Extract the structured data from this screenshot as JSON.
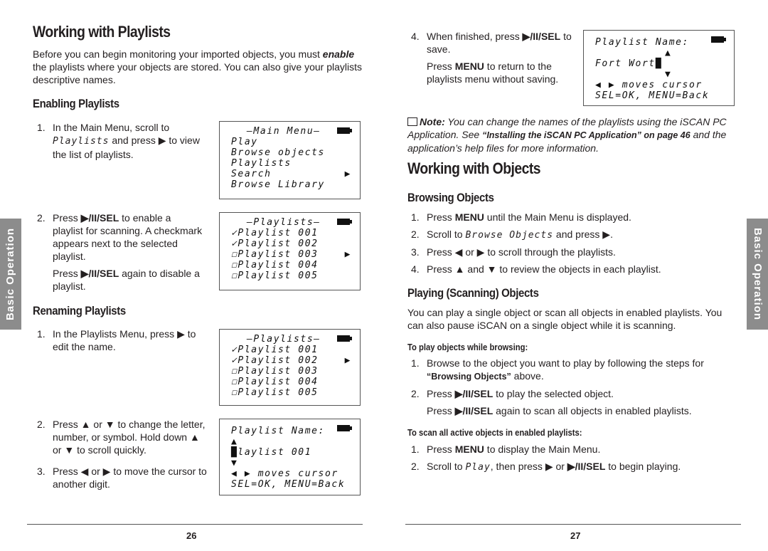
{
  "left": {
    "title": "Working with Playlists",
    "intro": [
      [
        "n",
        "Before you can begin monitoring your imported objects, you must "
      ],
      [
        "bi",
        "enable"
      ],
      [
        "n",
        " the playlists where your objects are stored. You can also give your playlists descriptive names."
      ]
    ],
    "enabling_heading": "Enabling Playlists",
    "enabling_steps": [
      {
        "num": "1.",
        "text": [
          [
            "n",
            "In the Main Menu, scroll to "
          ],
          [
            "lcd",
            "Playlists"
          ],
          [
            "n",
            " and press ▶ to view the list of playlists."
          ]
        ]
      },
      {
        "num": "2.",
        "text": [
          [
            "n",
            "Press "
          ],
          [
            "b",
            "▶/II/SEL"
          ],
          [
            "n",
            " to enable a playlist for scanning. A checkmark appears next to the selected playlist."
          ]
        ],
        "extra": [
          [
            "n",
            "Press "
          ],
          [
            "b",
            "▶/II/SEL"
          ],
          [
            "n",
            " again to disable a playlist."
          ]
        ]
      }
    ],
    "renaming_heading": "Renaming Playlists",
    "renaming_steps": [
      {
        "num": "1.",
        "text": [
          [
            "n",
            "In the Playlists Menu, press ▶ to edit the name."
          ]
        ]
      },
      {
        "num": "2.",
        "text": [
          [
            "n",
            "Press ▲ or ▼ to change the letter, number, or symbol. Hold down ▲ or ▼ to scroll quickly."
          ]
        ]
      },
      {
        "num": "3.",
        "text": [
          [
            "n",
            "Press ◀ or ▶ to move the cursor to another digit."
          ]
        ]
      }
    ],
    "lcd_main_menu": {
      "title": "–Main Menu–",
      "items": [
        "Play",
        "Browse objects",
        "Playlists",
        "Search",
        "Browse Library"
      ],
      "arrow": "▶"
    },
    "lcd_playlists_a": {
      "title": "–Playlists–",
      "items": [
        "✓Playlist 001",
        "✓Playlist 002",
        "☐Playlist 003",
        "☐Playlist 004",
        "☐Playlist 005"
      ],
      "arrow": "▶"
    },
    "lcd_playlists_b": {
      "title": "–Playlists–",
      "items": [
        "✓Playlist 001",
        "✓Playlist 002",
        "☐Playlist 003",
        "☐Playlist 004",
        "☐Playlist 005"
      ],
      "arrow": "▶"
    },
    "lcd_name_a": {
      "title": "Playlist Name:",
      "up": "▲",
      "value": "█laylist 001",
      "down": "▼",
      "hint": "◀ ▶ moves cursor",
      "keys": "SEL=OK, MENU=Back"
    },
    "side_tab": "Basic Operation",
    "page_number": "26"
  },
  "right": {
    "step4": {
      "num": "4.",
      "text": [
        [
          "n",
          "When finished, press "
        ],
        [
          "b",
          "▶/II/SEL"
        ],
        [
          "n",
          " to save."
        ]
      ],
      "extra": [
        [
          "n",
          "Press "
        ],
        [
          "b",
          "MENU"
        ],
        [
          "n",
          " to return to the playlists menu without saving."
        ]
      ]
    },
    "lcd_name_b": {
      "title": "Playlist Name:",
      "up": "▲",
      "value": "Fort Wort█",
      "down": "▼",
      "hint": "◀ ▶ moves cursor",
      "keys": "SEL=OK, MENU=Back"
    },
    "note": [
      [
        "bi",
        "Note:"
      ],
      [
        "i",
        " You can change the names of the playlists using the iSCAN PC Application. See "
      ],
      [
        "bc",
        "“Installing the iSCAN PC Application” on page 46"
      ],
      [
        "i",
        " and the application’s help files for more information."
      ]
    ],
    "title": "Working with Objects",
    "browsing_heading": "Browsing Objects",
    "browsing_steps": [
      {
        "num": "1.",
        "text": [
          [
            "n",
            "Press "
          ],
          [
            "b",
            "MENU"
          ],
          [
            "n",
            " until the Main Menu is displayed."
          ]
        ]
      },
      {
        "num": "2.",
        "text": [
          [
            "n",
            "Scroll to "
          ],
          [
            "lcd",
            "Browse Objects"
          ],
          [
            "n",
            " and press ▶."
          ]
        ]
      },
      {
        "num": "3.",
        "text": [
          [
            "n",
            "Press ◀ or ▶ to scroll through the playlists."
          ]
        ]
      },
      {
        "num": "4.",
        "text": [
          [
            "n",
            "Press ▲ and ▼ to review the objects in each playlist."
          ]
        ]
      }
    ],
    "playing_heading": "Playing (Scanning) Objects",
    "playing_intro": [
      [
        "n",
        "You can play a single object or scan all objects in enabled playlists. You can also pause iSCAN on a single object while it is scanning."
      ]
    ],
    "browse_play_heading": "To play objects while browsing:",
    "browse_play_steps": [
      {
        "num": "1.",
        "text": [
          [
            "n",
            "Browse to the object you want to play by following the steps for "
          ],
          [
            "bc",
            "“Browsing Objects”"
          ],
          [
            "n",
            " above."
          ]
        ]
      },
      {
        "num": "2.",
        "text": [
          [
            "n",
            "Press "
          ],
          [
            "b",
            "▶/II/SEL"
          ],
          [
            "n",
            " to play the selected object."
          ]
        ],
        "extra": [
          [
            "n",
            "Press "
          ],
          [
            "b",
            "▶/II/SEL"
          ],
          [
            "n",
            " again to scan all objects in enabled playlists."
          ]
        ]
      }
    ],
    "scan_heading": "To scan all active objects in enabled playlists:",
    "scan_steps": [
      {
        "num": "1.",
        "text": [
          [
            "n",
            "Press "
          ],
          [
            "b",
            "MENU"
          ],
          [
            "n",
            " to display the Main Menu."
          ]
        ]
      },
      {
        "num": "2.",
        "text": [
          [
            "n",
            "Scroll to "
          ],
          [
            "lcd",
            "Play"
          ],
          [
            "n",
            ", then press ▶ or "
          ],
          [
            "b",
            "▶/II/SEL"
          ],
          [
            "n",
            " to begin playing."
          ]
        ]
      }
    ],
    "side_tab": "Basic Operation",
    "page_number": "27"
  },
  "colors": {
    "side_tab": "#8c8c8c",
    "text": "#231f20"
  }
}
